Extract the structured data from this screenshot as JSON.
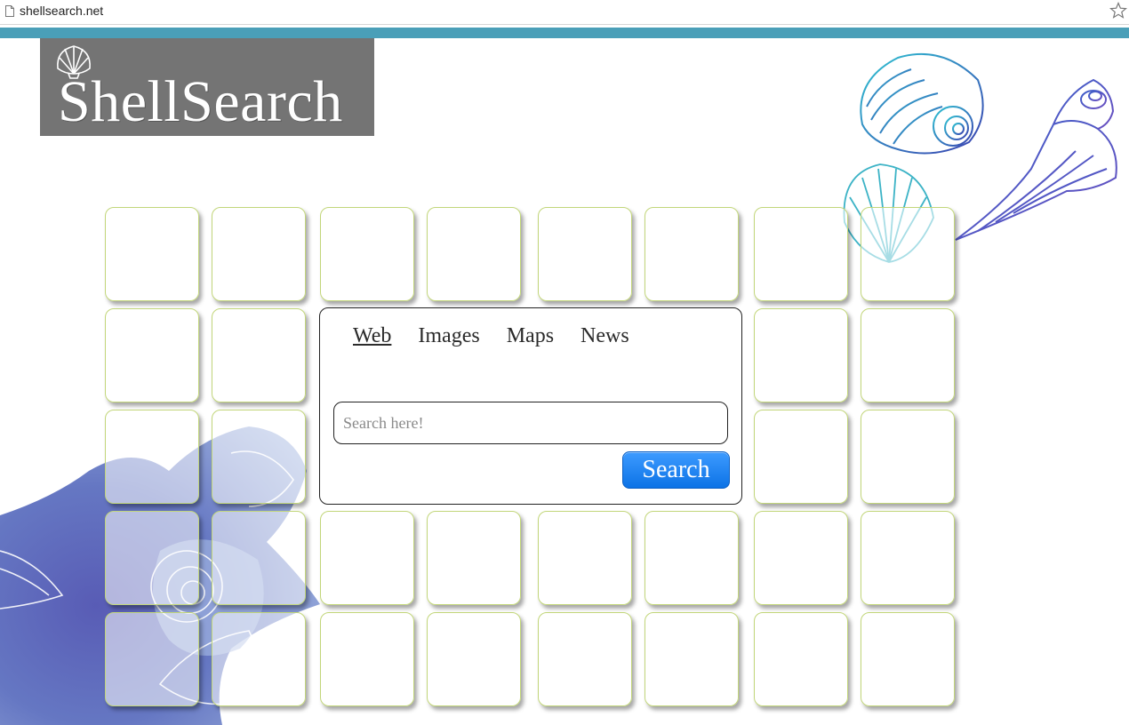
{
  "browser": {
    "url": "shellsearch.net"
  },
  "logo": {
    "text": "ShellSearch"
  },
  "colors": {
    "accent_bar": "#4a9fb8",
    "logo_bg": "#747474",
    "tile_border": "#c2d67a",
    "search_button": "#0c73e6"
  },
  "search": {
    "tabs": [
      {
        "label": "Web",
        "active": true
      },
      {
        "label": "Images",
        "active": false
      },
      {
        "label": "Maps",
        "active": false
      },
      {
        "label": "News",
        "active": false
      }
    ],
    "placeholder": "Search here!",
    "value": "",
    "button_label": "Search"
  },
  "icons": {
    "page": "page-icon",
    "bookmark": "star-icon",
    "logo_shell": "scallop-shell-icon"
  }
}
